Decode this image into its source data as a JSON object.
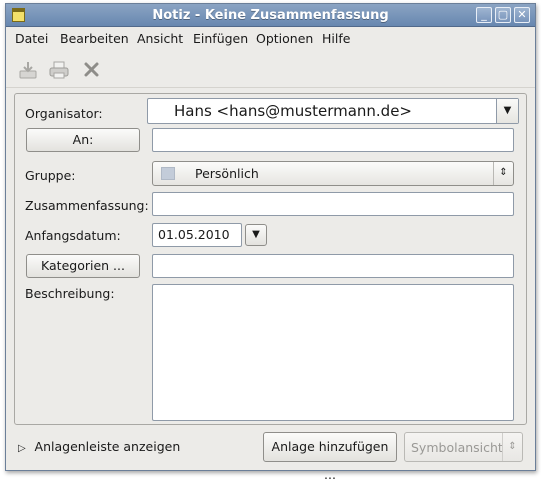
{
  "window": {
    "title": "Notiz - Keine Zusammenfassung"
  },
  "menu": [
    {
      "label": "Datei"
    },
    {
      "label": "Bearbeiten"
    },
    {
      "label": "Ansicht"
    },
    {
      "label": "Einfügen"
    },
    {
      "label": "Optionen"
    },
    {
      "label": "Hilfe"
    }
  ],
  "toolbar": {
    "icons": [
      "save-icon",
      "print-icon",
      "delete-icon"
    ]
  },
  "form": {
    "organizer_label": "Organisator:",
    "organizer_value": "Hans <hans@mustermann.de>",
    "to_button": "An:",
    "to_value": "",
    "group_label": "Gruppe:",
    "group_value": "Persönlich",
    "summary_label": "Zusammenfassung:",
    "summary_value": "",
    "start_date_label": "Anfangsdatum:",
    "start_date_value": "01.05.2010",
    "categories_button": "Kategorien ...",
    "categories_value": "",
    "description_label": "Beschreibung:",
    "description_value": ""
  },
  "bottom": {
    "attachments_toggle": "Anlagenleiste anzeigen",
    "add_attachment_button": "Anlage hinzufügen ...",
    "view_select": "Symbolansicht"
  },
  "colors": {
    "titlebar": "#7895bb",
    "window_bg": "#ecebe8",
    "disabled_text": "#9a9996"
  }
}
